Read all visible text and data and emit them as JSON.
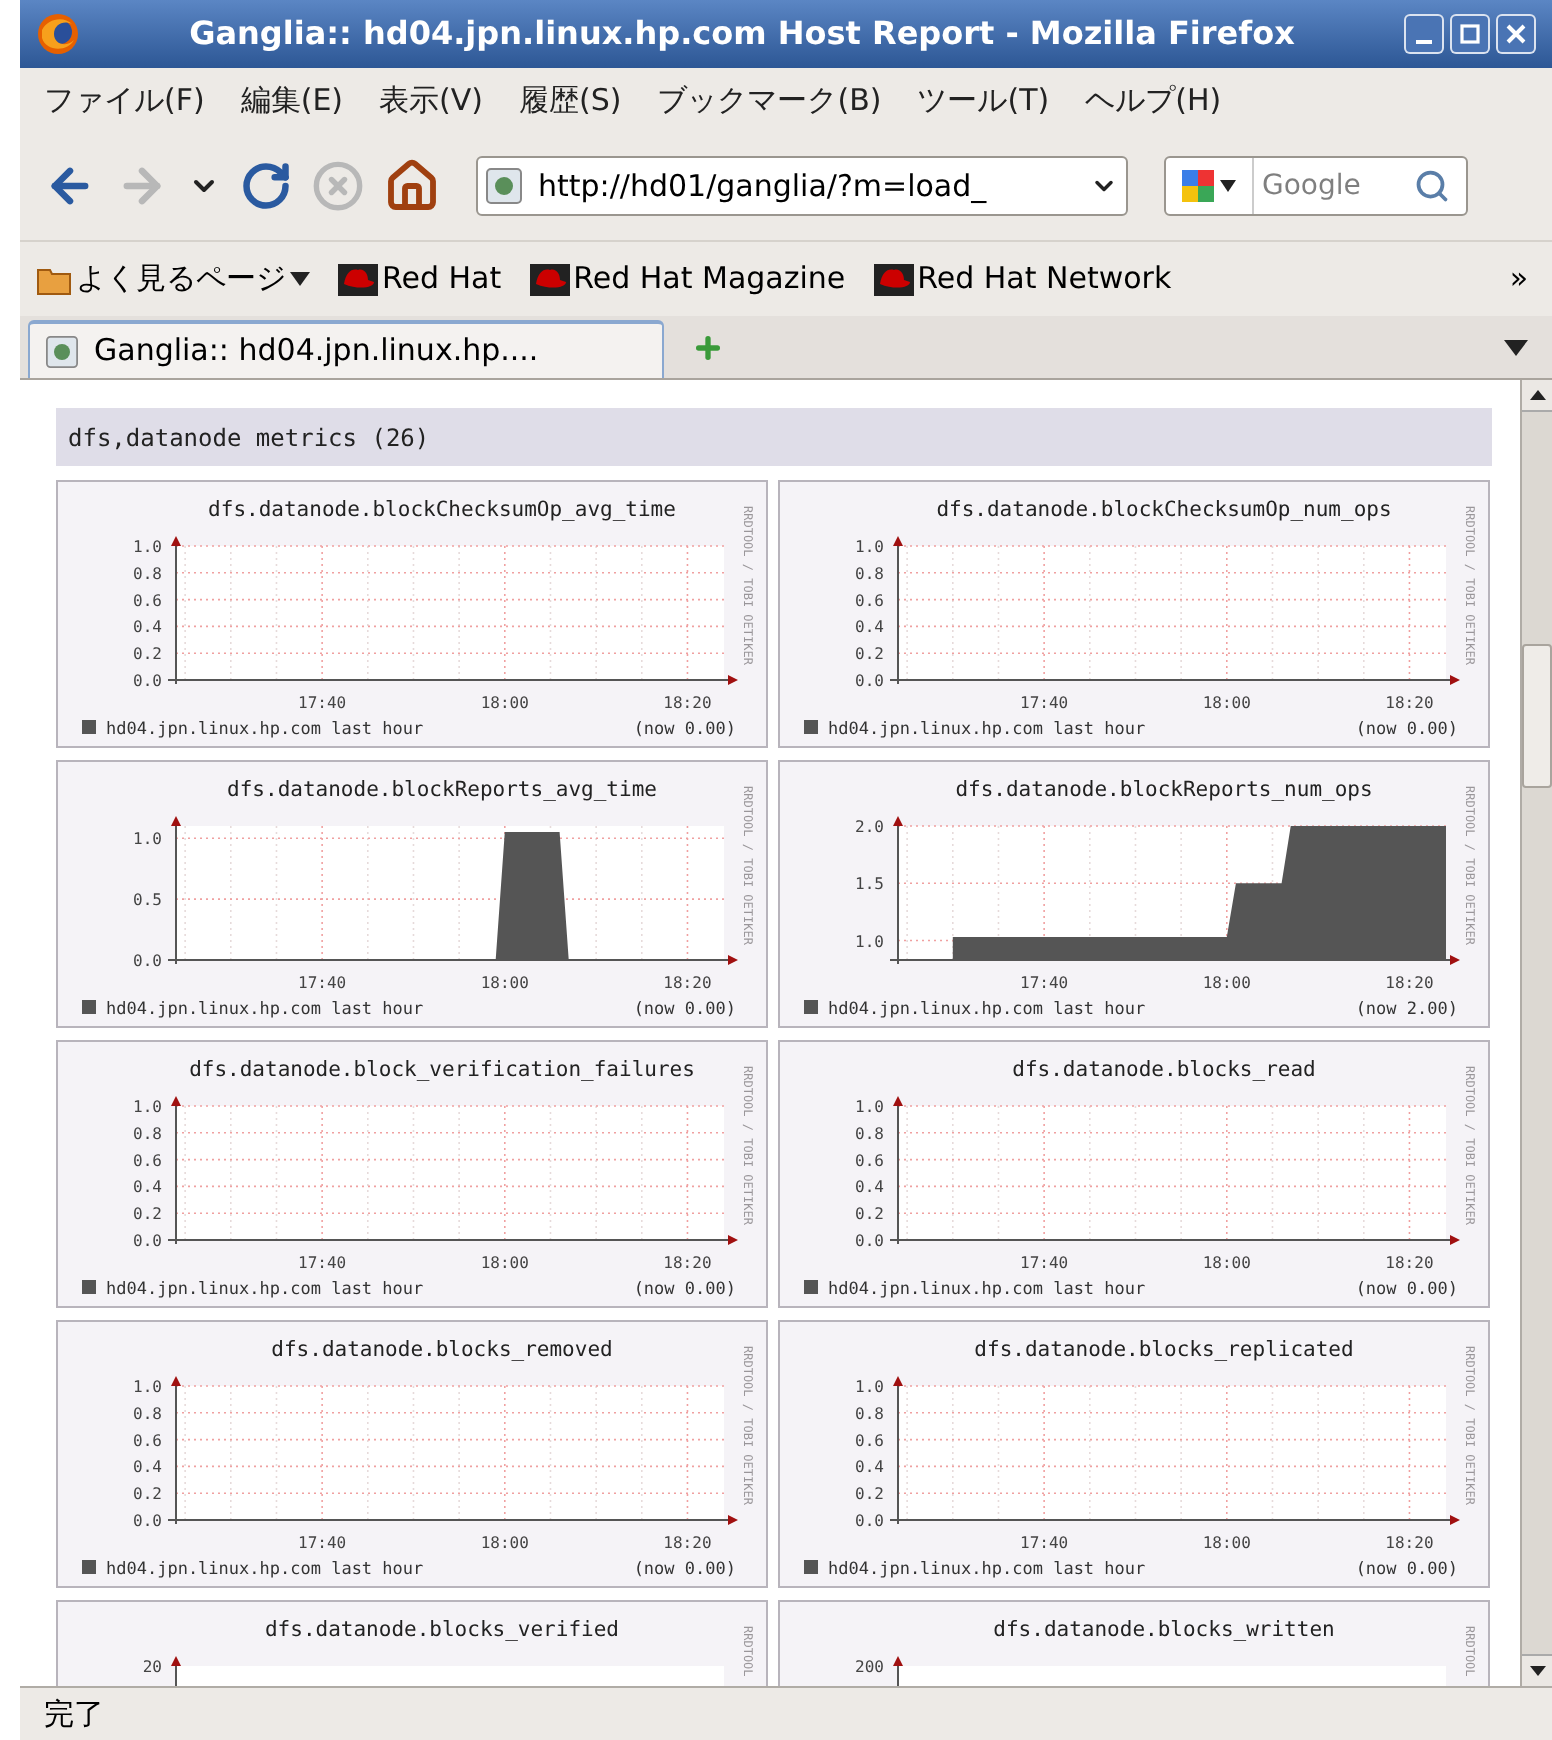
{
  "window": {
    "title": "Ganglia:: hd04.jpn.linux.hp.com Host Report - Mozilla Firefox"
  },
  "menu": [
    {
      "label": "ファイル(F)"
    },
    {
      "label": "編集(E)"
    },
    {
      "label": "表示(V)"
    },
    {
      "label": "履歴(S)"
    },
    {
      "label": "ブックマーク(B)"
    },
    {
      "label": "ツール(T)"
    },
    {
      "label": "ヘルプ(H)"
    }
  ],
  "toolbar": {
    "url": "http://hd01/ganglia/?m=load_",
    "search": {
      "placeholder": "Google"
    }
  },
  "bookmarks": {
    "items": [
      {
        "label": "よく見るページ",
        "kind": "folder"
      },
      {
        "label": "Red Hat",
        "kind": "link"
      },
      {
        "label": "Red Hat Magazine",
        "kind": "link"
      },
      {
        "label": "Red Hat Network",
        "kind": "link"
      }
    ],
    "overflow": "»"
  },
  "tabs": [
    {
      "label": "Ganglia::  hd04.jpn.linux.hp....",
      "selected": true
    }
  ],
  "section": {
    "title": "dfs,datanode metrics (26)"
  },
  "charts": [
    {
      "title": "dfs.datanode.blockChecksumOp_avg_time",
      "legend": {
        "period": "last hour"
      },
      "now": "(now 0.00)",
      "credit": "RRDTOOL / TOBI OETIKER",
      "chart_data": {
        "type": "line",
        "grid": true,
        "categories": [
          null,
          null,
          null,
          null,
          null,
          null,
          null,
          null,
          null,
          null,
          null,
          null,
          null,
          null,
          null,
          null,
          "17:40",
          null,
          null,
          null,
          null,
          null,
          null,
          null,
          null,
          null,
          null,
          null,
          null,
          null,
          null,
          null,
          null,
          null,
          null,
          null,
          "18:00",
          null,
          null,
          null,
          null,
          null,
          null,
          null,
          null,
          null,
          null,
          null,
          null,
          null,
          null,
          null,
          null,
          null,
          null,
          null,
          "18:20",
          null,
          null,
          null,
          null
        ],
        "ylim": [
          0,
          1
        ],
        "yticks": [
          {
            "value": 0,
            "label": "0.0"
          },
          {
            "value": 0.2,
            "label": "0.2"
          },
          {
            "value": 0.4,
            "label": "0.4"
          },
          {
            "value": 0.6,
            "label": "0.6"
          },
          {
            "value": 0.8,
            "label": "0.8"
          },
          {
            "value": 1,
            "label": "1.0"
          }
        ],
        "series": [
          {
            "name": "hd04.jpn.linux.hp.com",
            "color": "#555555",
            "values": [
              0,
              0,
              0,
              0,
              0,
              0,
              0,
              0,
              0,
              0,
              0,
              0,
              0,
              0,
              0,
              0,
              0,
              0,
              0,
              0,
              0,
              0,
              0,
              0,
              0,
              0,
              0,
              0,
              0,
              0,
              0,
              0,
              0,
              0,
              0,
              0,
              0,
              0,
              0,
              0,
              0,
              0,
              0,
              0,
              0,
              0,
              0,
              0,
              0,
              0,
              0,
              0,
              0,
              0,
              0,
              0,
              0,
              0,
              0,
              0,
              0
            ]
          }
        ]
      }
    },
    {
      "title": "dfs.datanode.blockChecksumOp_num_ops",
      "legend": {
        "period": "last hour"
      },
      "now": "(now 0.00)",
      "credit": "RRDTOOL / TOBI OETIKER",
      "chart_data": {
        "type": "line",
        "grid": true,
        "categories": [
          null,
          null,
          null,
          null,
          null,
          null,
          null,
          null,
          null,
          null,
          null,
          null,
          null,
          null,
          null,
          null,
          "17:40",
          null,
          null,
          null,
          null,
          null,
          null,
          null,
          null,
          null,
          null,
          null,
          null,
          null,
          null,
          null,
          null,
          null,
          null,
          null,
          "18:00",
          null,
          null,
          null,
          null,
          null,
          null,
          null,
          null,
          null,
          null,
          null,
          null,
          null,
          null,
          null,
          null,
          null,
          null,
          null,
          "18:20",
          null,
          null,
          null,
          null
        ],
        "ylim": [
          0,
          1
        ],
        "yticks": [
          {
            "value": 0,
            "label": "0.0"
          },
          {
            "value": 0.2,
            "label": "0.2"
          },
          {
            "value": 0.4,
            "label": "0.4"
          },
          {
            "value": 0.6,
            "label": "0.6"
          },
          {
            "value": 0.8,
            "label": "0.8"
          },
          {
            "value": 1,
            "label": "1.0"
          }
        ],
        "series": [
          {
            "name": "hd04.jpn.linux.hp.com",
            "color": "#555555",
            "values": [
              0,
              0,
              0,
              0,
              0,
              0,
              0,
              0,
              0,
              0,
              0,
              0,
              0,
              0,
              0,
              0,
              0,
              0,
              0,
              0,
              0,
              0,
              0,
              0,
              0,
              0,
              0,
              0,
              0,
              0,
              0,
              0,
              0,
              0,
              0,
              0,
              0,
              0,
              0,
              0,
              0,
              0,
              0,
              0,
              0,
              0,
              0,
              0,
              0,
              0,
              0,
              0,
              0,
              0,
              0,
              0,
              0,
              0,
              0,
              0,
              0
            ]
          }
        ]
      }
    },
    {
      "title": "dfs.datanode.blockReports_avg_time",
      "legend": {
        "period": "last hour"
      },
      "now": "(now 0.00)",
      "credit": "RRDTOOL / TOBI OETIKER",
      "chart_data": {
        "type": "area",
        "grid": true,
        "categories": [
          null,
          null,
          null,
          null,
          null,
          null,
          null,
          null,
          null,
          null,
          null,
          null,
          null,
          null,
          null,
          null,
          "17:40",
          null,
          null,
          null,
          null,
          null,
          null,
          null,
          null,
          null,
          null,
          null,
          null,
          null,
          null,
          null,
          null,
          null,
          null,
          null,
          "18:00",
          null,
          null,
          null,
          null,
          null,
          null,
          null,
          null,
          null,
          null,
          null,
          null,
          null,
          null,
          null,
          null,
          null,
          null,
          null,
          "18:20",
          null,
          null,
          null,
          null
        ],
        "ylim": [
          0,
          1.1
        ],
        "yticks": [
          {
            "value": 0,
            "label": "0.0"
          },
          {
            "value": 0.5,
            "label": "0.5"
          },
          {
            "value": 1,
            "label": "1.0"
          }
        ],
        "series": [
          {
            "name": "hd04.jpn.linux.hp.com",
            "color": "#555555",
            "values": [
              0,
              0,
              0,
              0,
              0,
              0,
              0,
              0,
              0,
              0,
              0,
              0,
              0,
              0,
              0,
              0,
              0,
              0,
              0,
              0,
              0,
              0,
              0,
              0,
              0,
              0,
              0,
              0,
              0,
              0,
              0,
              0,
              0,
              0,
              0,
              0,
              1.05,
              1.05,
              1.05,
              1.05,
              1.05,
              1.05,
              1.05,
              0,
              0,
              0,
              0,
              0,
              0,
              0,
              0,
              0,
              0,
              0,
              0,
              0,
              0,
              0,
              0,
              0,
              0
            ]
          }
        ]
      }
    },
    {
      "title": "dfs.datanode.blockReports_num_ops",
      "legend": {
        "period": "last hour"
      },
      "now": "(now 2.00)",
      "credit": "RRDTOOL / TOBI OETIKER",
      "chart_data": {
        "type": "area",
        "grid": true,
        "categories": [
          null,
          null,
          null,
          null,
          null,
          null,
          null,
          null,
          null,
          null,
          null,
          null,
          null,
          null,
          null,
          null,
          "17:40",
          null,
          null,
          null,
          null,
          null,
          null,
          null,
          null,
          null,
          null,
          null,
          null,
          null,
          null,
          null,
          null,
          null,
          null,
          null,
          "18:00",
          null,
          null,
          null,
          null,
          null,
          null,
          null,
          null,
          null,
          null,
          null,
          null,
          null,
          null,
          null,
          null,
          null,
          null,
          null,
          "18:20",
          null,
          null,
          null,
          null
        ],
        "ylim": [
          0.83,
          2
        ],
        "yticks": [
          {
            "value": 1,
            "label": "1.0"
          },
          {
            "value": 1.5,
            "label": "1.5"
          },
          {
            "value": 2,
            "label": "2.0"
          }
        ],
        "series": [
          {
            "name": "hd04.jpn.linux.hp.com",
            "color": "#555555",
            "values": [
              null,
              null,
              null,
              null,
              null,
              null,
              1.03,
              1.03,
              1.03,
              1.03,
              1.03,
              1.03,
              1.03,
              1.03,
              1.03,
              1.03,
              1.03,
              1.03,
              1.03,
              1.03,
              1.03,
              1.03,
              1.03,
              1.03,
              1.03,
              1.03,
              1.03,
              1.03,
              1.03,
              1.03,
              1.03,
              1.03,
              1.03,
              1.03,
              1.03,
              1.03,
              1.03,
              1.5,
              1.5,
              1.5,
              1.5,
              1.5,
              1.5,
              2,
              2,
              2,
              2,
              2,
              2,
              2,
              2,
              2,
              2,
              2,
              2,
              2,
              2,
              2,
              2,
              2,
              2
            ]
          }
        ]
      }
    },
    {
      "title": "dfs.datanode.block_verification_failures",
      "legend": {
        "period": "last hour"
      },
      "now": "(now 0.00)",
      "credit": "RRDTOOL / TOBI OETIKER",
      "chart_data": {
        "type": "line",
        "grid": true,
        "categories": [
          null,
          null,
          null,
          null,
          null,
          null,
          null,
          null,
          null,
          null,
          null,
          null,
          null,
          null,
          null,
          null,
          "17:40",
          null,
          null,
          null,
          null,
          null,
          null,
          null,
          null,
          null,
          null,
          null,
          null,
          null,
          null,
          null,
          null,
          null,
          null,
          null,
          "18:00",
          null,
          null,
          null,
          null,
          null,
          null,
          null,
          null,
          null,
          null,
          null,
          null,
          null,
          null,
          null,
          null,
          null,
          null,
          null,
          "18:20",
          null,
          null,
          null,
          null
        ],
        "ylim": [
          0,
          1
        ],
        "yticks": [
          {
            "value": 0,
            "label": "0.0"
          },
          {
            "value": 0.2,
            "label": "0.2"
          },
          {
            "value": 0.4,
            "label": "0.4"
          },
          {
            "value": 0.6,
            "label": "0.6"
          },
          {
            "value": 0.8,
            "label": "0.8"
          },
          {
            "value": 1,
            "label": "1.0"
          }
        ],
        "series": [
          {
            "name": "hd04.jpn.linux.hp.com",
            "color": "#555555",
            "values": [
              0,
              0,
              0,
              0,
              0,
              0,
              0,
              0,
              0,
              0,
              0,
              0,
              0,
              0,
              0,
              0,
              0,
              0,
              0,
              0,
              0,
              0,
              0,
              0,
              0,
              0,
              0,
              0,
              0,
              0,
              0,
              0,
              0,
              0,
              0,
              0,
              0,
              0,
              0,
              0,
              0,
              0,
              0,
              0,
              0,
              0,
              0,
              0,
              0,
              0,
              0,
              0,
              0,
              0,
              0,
              0,
              0,
              0,
              0,
              0,
              0
            ]
          }
        ]
      }
    },
    {
      "title": "dfs.datanode.blocks_read",
      "legend": {
        "period": "last hour"
      },
      "now": "(now 0.00)",
      "credit": "RRDTOOL / TOBI OETIKER",
      "chart_data": {
        "type": "line",
        "grid": true,
        "categories": [
          null,
          null,
          null,
          null,
          null,
          null,
          null,
          null,
          null,
          null,
          null,
          null,
          null,
          null,
          null,
          null,
          "17:40",
          null,
          null,
          null,
          null,
          null,
          null,
          null,
          null,
          null,
          null,
          null,
          null,
          null,
          null,
          null,
          null,
          null,
          null,
          null,
          "18:00",
          null,
          null,
          null,
          null,
          null,
          null,
          null,
          null,
          null,
          null,
          null,
          null,
          null,
          null,
          null,
          null,
          null,
          null,
          null,
          "18:20",
          null,
          null,
          null,
          null
        ],
        "ylim": [
          0,
          1
        ],
        "yticks": [
          {
            "value": 0,
            "label": "0.0"
          },
          {
            "value": 0.2,
            "label": "0.2"
          },
          {
            "value": 0.4,
            "label": "0.4"
          },
          {
            "value": 0.6,
            "label": "0.6"
          },
          {
            "value": 0.8,
            "label": "0.8"
          },
          {
            "value": 1,
            "label": "1.0"
          }
        ],
        "series": [
          {
            "name": "hd04.jpn.linux.hp.com",
            "color": "#555555",
            "values": [
              0,
              0,
              0,
              0,
              0,
              0,
              0,
              0,
              0,
              0,
              0,
              0,
              0,
              0,
              0,
              0,
              0,
              0,
              0,
              0,
              0,
              0,
              0,
              0,
              0,
              0,
              0,
              0,
              0,
              0,
              0,
              0,
              0,
              0,
              0,
              0,
              0,
              0,
              0,
              0,
              0,
              0,
              0,
              0,
              0,
              0,
              0,
              0,
              0,
              0,
              0,
              0,
              0,
              0,
              0,
              0,
              0,
              0,
              0,
              0,
              0
            ]
          }
        ]
      }
    },
    {
      "title": "dfs.datanode.blocks_removed",
      "legend": {
        "period": "last hour"
      },
      "now": "(now 0.00)",
      "credit": "RRDTOOL / TOBI OETIKER",
      "chart_data": {
        "type": "line",
        "grid": true,
        "categories": [
          null,
          null,
          null,
          null,
          null,
          null,
          null,
          null,
          null,
          null,
          null,
          null,
          null,
          null,
          null,
          null,
          "17:40",
          null,
          null,
          null,
          null,
          null,
          null,
          null,
          null,
          null,
          null,
          null,
          null,
          null,
          null,
          null,
          null,
          null,
          null,
          null,
          "18:00",
          null,
          null,
          null,
          null,
          null,
          null,
          null,
          null,
          null,
          null,
          null,
          null,
          null,
          null,
          null,
          null,
          null,
          null,
          null,
          "18:20",
          null,
          null,
          null,
          null
        ],
        "ylim": [
          0,
          1
        ],
        "yticks": [
          {
            "value": 0,
            "label": "0.0"
          },
          {
            "value": 0.2,
            "label": "0.2"
          },
          {
            "value": 0.4,
            "label": "0.4"
          },
          {
            "value": 0.6,
            "label": "0.6"
          },
          {
            "value": 0.8,
            "label": "0.8"
          },
          {
            "value": 1,
            "label": "1.0"
          }
        ],
        "series": [
          {
            "name": "hd04.jpn.linux.hp.com",
            "color": "#555555",
            "values": [
              0,
              0,
              0,
              0,
              0,
              0,
              0,
              0,
              0,
              0,
              0,
              0,
              0,
              0,
              0,
              0,
              0,
              0,
              0,
              0,
              0,
              0,
              0,
              0,
              0,
              0,
              0,
              0,
              0,
              0,
              0,
              0,
              0,
              0,
              0,
              0,
              0,
              0,
              0,
              0,
              0,
              0,
              0,
              0,
              0,
              0,
              0,
              0,
              0,
              0,
              0,
              0,
              0,
              0,
              0,
              0,
              0,
              0,
              0,
              0,
              0
            ]
          }
        ]
      }
    },
    {
      "title": "dfs.datanode.blocks_replicated",
      "legend": {
        "period": "last hour"
      },
      "now": "(now 0.00)",
      "credit": "RRDTOOL / TOBI OETIKER",
      "chart_data": {
        "type": "line",
        "grid": true,
        "categories": [
          null,
          null,
          null,
          null,
          null,
          null,
          null,
          null,
          null,
          null,
          null,
          null,
          null,
          null,
          null,
          null,
          "17:40",
          null,
          null,
          null,
          null,
          null,
          null,
          null,
          null,
          null,
          null,
          null,
          null,
          null,
          null,
          null,
          null,
          null,
          null,
          null,
          "18:00",
          null,
          null,
          null,
          null,
          null,
          null,
          null,
          null,
          null,
          null,
          null,
          null,
          null,
          null,
          null,
          null,
          null,
          null,
          null,
          "18:20",
          null,
          null,
          null,
          null
        ],
        "ylim": [
          0,
          1
        ],
        "yticks": [
          {
            "value": 0,
            "label": "0.0"
          },
          {
            "value": 0.2,
            "label": "0.2"
          },
          {
            "value": 0.4,
            "label": "0.4"
          },
          {
            "value": 0.6,
            "label": "0.6"
          },
          {
            "value": 0.8,
            "label": "0.8"
          },
          {
            "value": 1,
            "label": "1.0"
          }
        ],
        "series": [
          {
            "name": "hd04.jpn.linux.hp.com",
            "color": "#555555",
            "values": [
              0,
              0,
              0,
              0,
              0,
              0,
              0,
              0,
              0,
              0,
              0,
              0,
              0,
              0,
              0,
              0,
              0,
              0,
              0,
              0,
              0,
              0,
              0,
              0,
              0,
              0,
              0,
              0,
              0,
              0,
              0,
              0,
              0,
              0,
              0,
              0,
              0,
              0,
              0,
              0,
              0,
              0,
              0,
              0,
              0,
              0,
              0,
              0,
              0,
              0,
              0,
              0,
              0,
              0,
              0,
              0,
              0,
              0,
              0,
              0,
              0
            ]
          }
        ]
      }
    },
    {
      "title": "dfs.datanode.blocks_verified",
      "credit": "RRDTOOL",
      "top_tick": "20"
    },
    {
      "title": "dfs.datanode.blocks_written",
      "credit": "RRDTOOL",
      "top_tick": "200"
    }
  ],
  "status_bar": {
    "text": "完了"
  }
}
